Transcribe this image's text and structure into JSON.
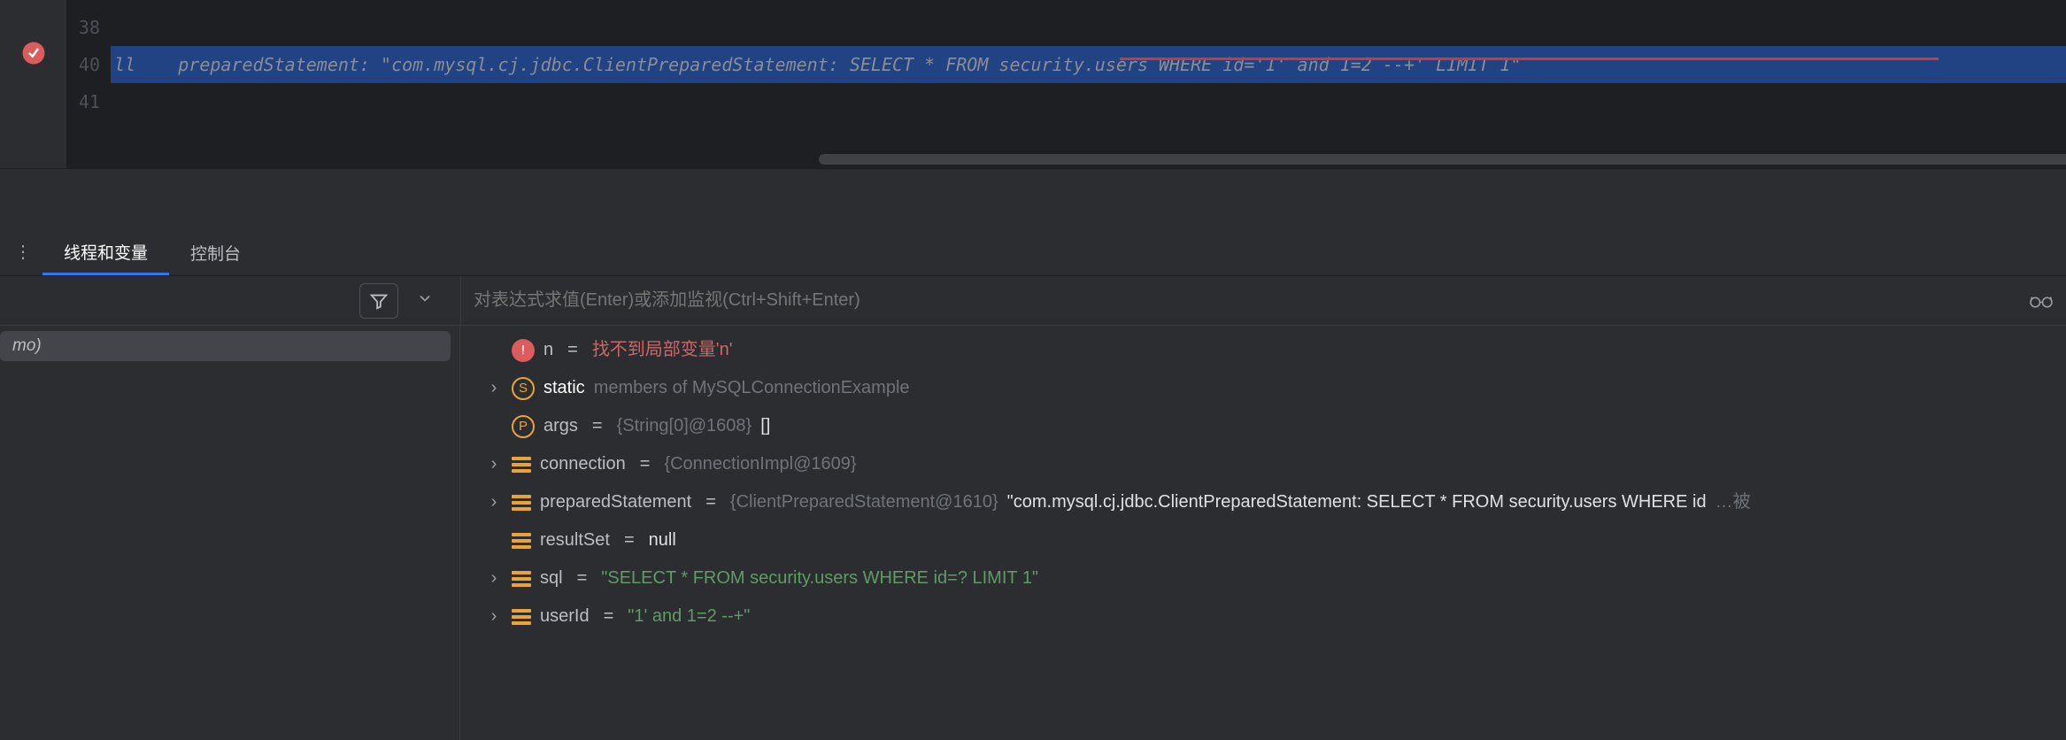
{
  "editor": {
    "line_numbers": [
      "38",
      "",
      "40",
      "41"
    ],
    "highlighted_line": "ll    preparedStatement: \"com.mysql.cj.jdbc.ClientPreparedStatement: SELECT * FROM security.users WHERE id='1' and 1=2 --+' LIMIT 1\""
  },
  "tabs": {
    "threads_vars": "线程和变量",
    "console": "控制台"
  },
  "eval": {
    "placeholder": "对表达式求值(Enter)或添加监视(Ctrl+Shift+Enter)"
  },
  "frames": {
    "item": "mo)"
  },
  "vars": [
    {
      "arrow": false,
      "icon": "err",
      "name": "n",
      "op": "=",
      "value": "找不到局部变量'n'",
      "valclass": "v-err"
    },
    {
      "arrow": true,
      "icon": "s",
      "name_bold": "static",
      "rest": " members of MySQLConnectionExample"
    },
    {
      "arrow": false,
      "icon": "p",
      "name": "args",
      "op": "=",
      "obj": "{String[0]@1608}",
      "tail": " []"
    },
    {
      "arrow": true,
      "icon": "stack",
      "name": "connection",
      "op": "=",
      "obj": "{ConnectionImpl@1609}"
    },
    {
      "arrow": true,
      "icon": "stack",
      "name": "preparedStatement",
      "op": "=",
      "obj": "{ClientPreparedStatement@1610}",
      "str": " \"com.mysql.cj.jdbc.ClientPreparedStatement: SELECT * FROM security.users WHERE id",
      "trunc": "…被"
    },
    {
      "arrow": false,
      "icon": "stack",
      "name": "resultSet",
      "op": "=",
      "plain": "null"
    },
    {
      "arrow": true,
      "icon": "stack",
      "name": "sql",
      "op": "=",
      "str": "\"SELECT * FROM security.users WHERE id=? LIMIT 1\""
    },
    {
      "arrow": true,
      "icon": "stack",
      "name": "userId",
      "op": "=",
      "str": "\"1' and 1=2 --+\""
    }
  ]
}
